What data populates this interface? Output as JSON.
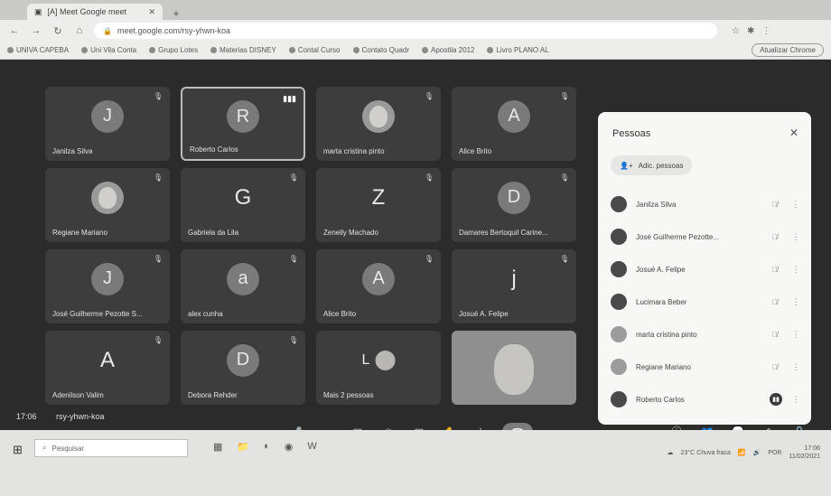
{
  "browser": {
    "tab_title": "[A] Meet Google meet",
    "url": "meet.google.com/rsy-yhwn-koa",
    "bookmarks": [
      "UNIVA CAPEBA",
      "Uni Vila Conta",
      "Grupo Lotes",
      "Materias DISNEY",
      "Contal Curso",
      "Contato Quadr",
      "Apostila 2012",
      "Livro PLANO AL"
    ],
    "profile_label": "Atualizar Chrome"
  },
  "meeting": {
    "time": "17:06",
    "code": "rsy-yhwn-koa"
  },
  "tiles": [
    {
      "initial": "J",
      "name": "Janilza Silva",
      "kind": "avatar"
    },
    {
      "initial": "R",
      "name": "Roberto Carlos",
      "kind": "avatar",
      "speaking": true
    },
    {
      "initial": "",
      "name": "marta cristina pinto",
      "kind": "photo"
    },
    {
      "initial": "A",
      "name": "Alice Brito",
      "kind": "avatar"
    },
    {
      "initial": "",
      "name": "Regiane Mariano",
      "kind": "photo"
    },
    {
      "initial": "G",
      "name": "Gabriela da Lila",
      "kind": "plain"
    },
    {
      "initial": "Z",
      "name": "Zenelly Machado",
      "kind": "plain"
    },
    {
      "initial": "D",
      "name": "Damares Bertoquil Carine...",
      "kind": "avatar"
    },
    {
      "initial": "J",
      "name": "José Guilherme Pezotte S...",
      "kind": "avatar"
    },
    {
      "initial": "a",
      "name": "alex cunha",
      "kind": "avatar"
    },
    {
      "initial": "A",
      "name": "Alice Brito",
      "kind": "avatar"
    },
    {
      "initial": "j",
      "name": "Josué A. Felipe",
      "kind": "plain"
    },
    {
      "initial": "A",
      "name": "Adenilson Valim",
      "kind": "plain"
    },
    {
      "initial": "D",
      "name": "Debora Rehder",
      "kind": "avatar"
    },
    {
      "initial": "L",
      "name": "Mais 2 pessoas",
      "kind": "more"
    },
    {
      "initial": "",
      "name": "",
      "kind": "self"
    }
  ],
  "people_panel": {
    "title": "Pessoas",
    "add_label": "Adic. pessoas",
    "people": [
      {
        "name": "Janilza Silva",
        "status": "muted"
      },
      {
        "name": "José Guilherme Pezotte...",
        "status": "muted"
      },
      {
        "name": "Josué A. Felipe",
        "status": "muted"
      },
      {
        "name": "Lucimara Beber",
        "status": "muted"
      },
      {
        "name": "marta cristina pinto",
        "status": "muted"
      },
      {
        "name": "Regiane Mariano",
        "status": "muted"
      },
      {
        "name": "Roberto Carlos",
        "status": "speaking"
      }
    ]
  },
  "taskbar": {
    "search_placeholder": "Pesquisar",
    "weather": "23°C Chuva fraca",
    "lang": "POR",
    "clock_time": "17:06",
    "clock_date": "11/02/2021"
  }
}
